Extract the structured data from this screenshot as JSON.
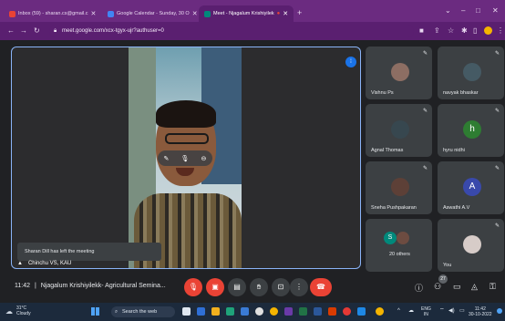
{
  "browser": {
    "tabs": [
      {
        "label": "Inbox (59) - sharan.cs@gmail.c",
        "icon": "gmail-icon",
        "color": "#ea4335"
      },
      {
        "label": "Google Calendar - Sunday, 30 O",
        "icon": "calendar-icon",
        "color": "#4285f4"
      },
      {
        "label": "Meet - Njagalum Krishiyilek",
        "icon": "meet-icon",
        "color": "#00897b"
      }
    ],
    "new_tab": "+",
    "url": "meet.google.com/xcx-tgyx-ujr?authuser=0"
  },
  "meeting": {
    "main_speaker_name": "Chinchu VS, KAU",
    "toast": "Sharan Dill has left the meeting",
    "hover_controls": [
      "pin-icon",
      "mic-icon",
      "remove-icon"
    ],
    "participants": [
      {
        "name": "Vishnu Ps",
        "avatar": "photo",
        "color": "#8d6e63"
      },
      {
        "name": "navyak bhaskar",
        "avatar": "photo",
        "color": "#455a64"
      },
      {
        "name": "Agnal Thomas",
        "avatar": "photo",
        "color": "#37474f"
      },
      {
        "name": "hyru nidhi",
        "avatar": "h",
        "color": "#2e7d32"
      },
      {
        "name": "Sneha Pushpakaran",
        "avatar": "photo",
        "color": "#5d4037"
      },
      {
        "name": "Aswathi A.V",
        "avatar": "A",
        "color": "#3949ab"
      },
      {
        "name": "20 others",
        "avatar": "group",
        "color": "#00897b"
      },
      {
        "name": "You",
        "avatar": "photo",
        "color": "#d7ccc8"
      }
    ]
  },
  "controls": {
    "time": "11:42",
    "meeting_title": "Njagalum Krishiyilekk- Agricultural Semina...",
    "participant_count": "27",
    "buttons": [
      "mic-off-icon",
      "camera-off-icon",
      "captions-icon",
      "raise-hand-icon",
      "present-icon",
      "more-icon",
      "leave-call-icon"
    ],
    "right_icons": [
      "info-icon",
      "people-icon",
      "chat-icon",
      "activities-icon",
      "host-controls-icon"
    ]
  },
  "taskbar": {
    "temperature": "31°C",
    "weather": "Cloudy",
    "search_placeholder": "Search the web",
    "language": "ENG",
    "region": "IN",
    "time": "11:42",
    "date": "30-10-2022"
  },
  "colors": {
    "browser_bg": "#6b2b80",
    "meet_bg": "#202124",
    "tile_bg": "#3c4043",
    "leave_red": "#ea4335",
    "active_border": "#8ab4f8"
  }
}
